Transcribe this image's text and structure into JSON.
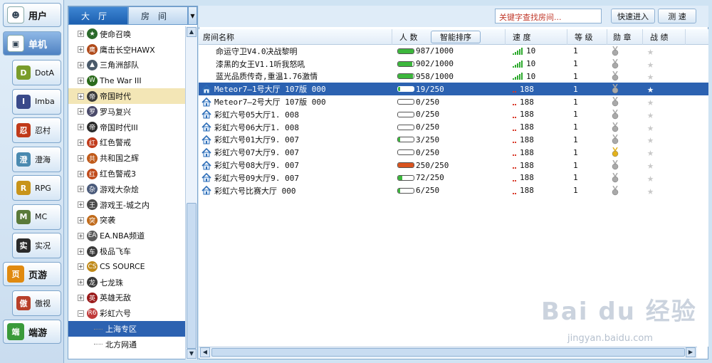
{
  "left_nav": {
    "top": [
      {
        "label": "用户",
        "icon": "user-icon",
        "active": false
      },
      {
        "label": "单机",
        "icon": "single-player-icon",
        "active": true
      }
    ],
    "sub": [
      {
        "label": "DotA",
        "icon": "dota-icon",
        "color": "#7a9c2a",
        "glyph": "D"
      },
      {
        "label": "Imba",
        "icon": "imba-icon",
        "color": "#3a4a8a",
        "glyph": "I"
      },
      {
        "label": "忍村",
        "icon": "ninja-icon",
        "color": "#c03a1a",
        "glyph": "忍"
      },
      {
        "label": "澄海",
        "icon": "chenghai-icon",
        "color": "#4a8ab0",
        "glyph": "澄"
      },
      {
        "label": "RPG",
        "icon": "rpg-icon",
        "color": "#c8941a",
        "glyph": "R"
      },
      {
        "label": "MC",
        "icon": "mc-icon",
        "color": "#5a7a3a",
        "glyph": "M"
      },
      {
        "label": "实况",
        "icon": "soccer-icon",
        "color": "#2a2a2a",
        "glyph": "实"
      }
    ],
    "bottom": [
      {
        "label": "页游",
        "icon": "webgame-icon",
        "color": "#e08a10",
        "glyph": "页",
        "style": "top"
      },
      {
        "label": "傲视",
        "icon": "aoshi-icon",
        "color": "#b8402a",
        "glyph": "傲",
        "style": "sub"
      },
      {
        "label": "端游",
        "icon": "client-game-icon",
        "color": "#3a9a3a",
        "glyph": "端",
        "style": "top"
      }
    ]
  },
  "tabs": {
    "hall": "大厅",
    "room": "房间"
  },
  "tree": {
    "games": [
      {
        "label": "使命召唤",
        "color": "#2b6a2b",
        "glyph": "★"
      },
      {
        "label": "鹰击长空HAWX",
        "color": "#b04a1a",
        "glyph": "鹰"
      },
      {
        "label": "三角洲部队",
        "color": "#4a5a6a",
        "glyph": "▲"
      },
      {
        "label": "The War III",
        "color": "#2a6a1a",
        "glyph": "W"
      },
      {
        "label": "帝国时代",
        "color": "#3a3a3a",
        "glyph": "帝"
      },
      {
        "label": "罗马复兴",
        "color": "#4a4a6a",
        "glyph": "罗"
      },
      {
        "label": "帝国时代III",
        "color": "#2a2a2a",
        "glyph": "帝"
      },
      {
        "label": "红色警戒",
        "color": "#c03a1a",
        "glyph": "红"
      },
      {
        "label": "共和国之辉",
        "color": "#c05a1a",
        "glyph": "共"
      },
      {
        "label": "红色警戒3",
        "color": "#c04a1a",
        "glyph": "红"
      },
      {
        "label": "游戏大杂烩",
        "color": "#4a5a7a",
        "glyph": "杂"
      },
      {
        "label": "游戏王-城之内",
        "color": "#4a4a4a",
        "glyph": "王"
      },
      {
        "label": "突袭",
        "color": "#c06a1a",
        "glyph": "突"
      },
      {
        "label": "EA.NBA频道",
        "color": "#5a5a5a",
        "glyph": "EA"
      },
      {
        "label": "极品飞车",
        "color": "#3a3a3a",
        "glyph": "车"
      },
      {
        "label": "CS SOURCE",
        "color": "#c08a1a",
        "glyph": "CS"
      },
      {
        "label": "七龙珠",
        "color": "#3a3a3a",
        "glyph": "龙"
      },
      {
        "label": "英雄无敌",
        "color": "#9a1a1a",
        "glyph": "英"
      },
      {
        "label": "彩虹六号",
        "color": "#c03a3a",
        "glyph": "R6"
      }
    ],
    "selected_index": 4,
    "children": [
      {
        "label": "上海专区",
        "selected": true
      },
      {
        "label": "北方网通",
        "selected": false
      }
    ]
  },
  "search": {
    "placeholder": "关键字查找房间..."
  },
  "buttons": {
    "quick_join": "快速进入",
    "speed_test": "测 速",
    "smart_sort": "智能排序"
  },
  "columns": {
    "name": "房间名称",
    "people": "人 数",
    "speed": "速 度",
    "level": "等 级",
    "medal": "勋 章",
    "record": "战 绩"
  },
  "rooms": [
    {
      "name": "命运守卫V4.0决战黎明",
      "icon": false,
      "count": "987/1000",
      "fill": 0.99,
      "speed": "10",
      "signal": "good",
      "level": "1",
      "medal": "silver"
    },
    {
      "name": "漆黑的女王V1.1听我怒吼",
      "icon": false,
      "count": "902/1000",
      "fill": 0.9,
      "speed": "10",
      "signal": "good",
      "level": "1",
      "medal": "silver"
    },
    {
      "name": "蓝光品质传奇,重温1.76激情",
      "icon": false,
      "count": "958/1000",
      "fill": 0.96,
      "speed": "10",
      "signal": "good",
      "level": "1",
      "medal": "silver"
    },
    {
      "name": "Meteor7—1号大厅 107版 000",
      "icon": true,
      "count": "19/250",
      "fill": 0.08,
      "speed": "188",
      "signal": "low",
      "level": "1",
      "medal": "silver",
      "selected": true
    },
    {
      "name": "Meteor7—2号大厅 107版 000",
      "icon": true,
      "count": "0/250",
      "fill": 0,
      "speed": "188",
      "signal": "low",
      "level": "1",
      "medal": "silver"
    },
    {
      "name": "彩虹六号05大厅1. 008",
      "icon": true,
      "count": "0/250",
      "fill": 0,
      "speed": "188",
      "signal": "low",
      "level": "1",
      "medal": "silver"
    },
    {
      "name": "彩虹六号06大厅1. 008",
      "icon": true,
      "count": "0/250",
      "fill": 0,
      "speed": "188",
      "signal": "low",
      "level": "1",
      "medal": "silver"
    },
    {
      "name": "彩虹六号01大厅9. 007",
      "icon": true,
      "count": "3/250",
      "fill": 0.01,
      "speed": "188",
      "signal": "low",
      "level": "1",
      "medal": "silver"
    },
    {
      "name": "彩虹六号07大厅9. 007",
      "icon": true,
      "count": "0/250",
      "fill": 0,
      "speed": "188",
      "signal": "low",
      "level": "1",
      "medal": "gold"
    },
    {
      "name": "彩虹六号08大厅9. 007",
      "icon": true,
      "count": "250/250",
      "fill": 1,
      "speed": "188",
      "signal": "low",
      "level": "1",
      "medal": "silver",
      "full": true
    },
    {
      "name": "彩虹六号09大厅9. 007",
      "icon": true,
      "count": "72/250",
      "fill": 0.29,
      "speed": "188",
      "signal": "low",
      "level": "1",
      "medal": "silver"
    },
    {
      "name": "彩虹六号比赛大厅 000",
      "icon": true,
      "count": "6/250",
      "fill": 0.02,
      "speed": "188",
      "signal": "low",
      "level": "1",
      "medal": "silver"
    }
  ],
  "watermark": {
    "main": "Bai du 经验",
    "sub": "jingyan.baidu.com"
  }
}
